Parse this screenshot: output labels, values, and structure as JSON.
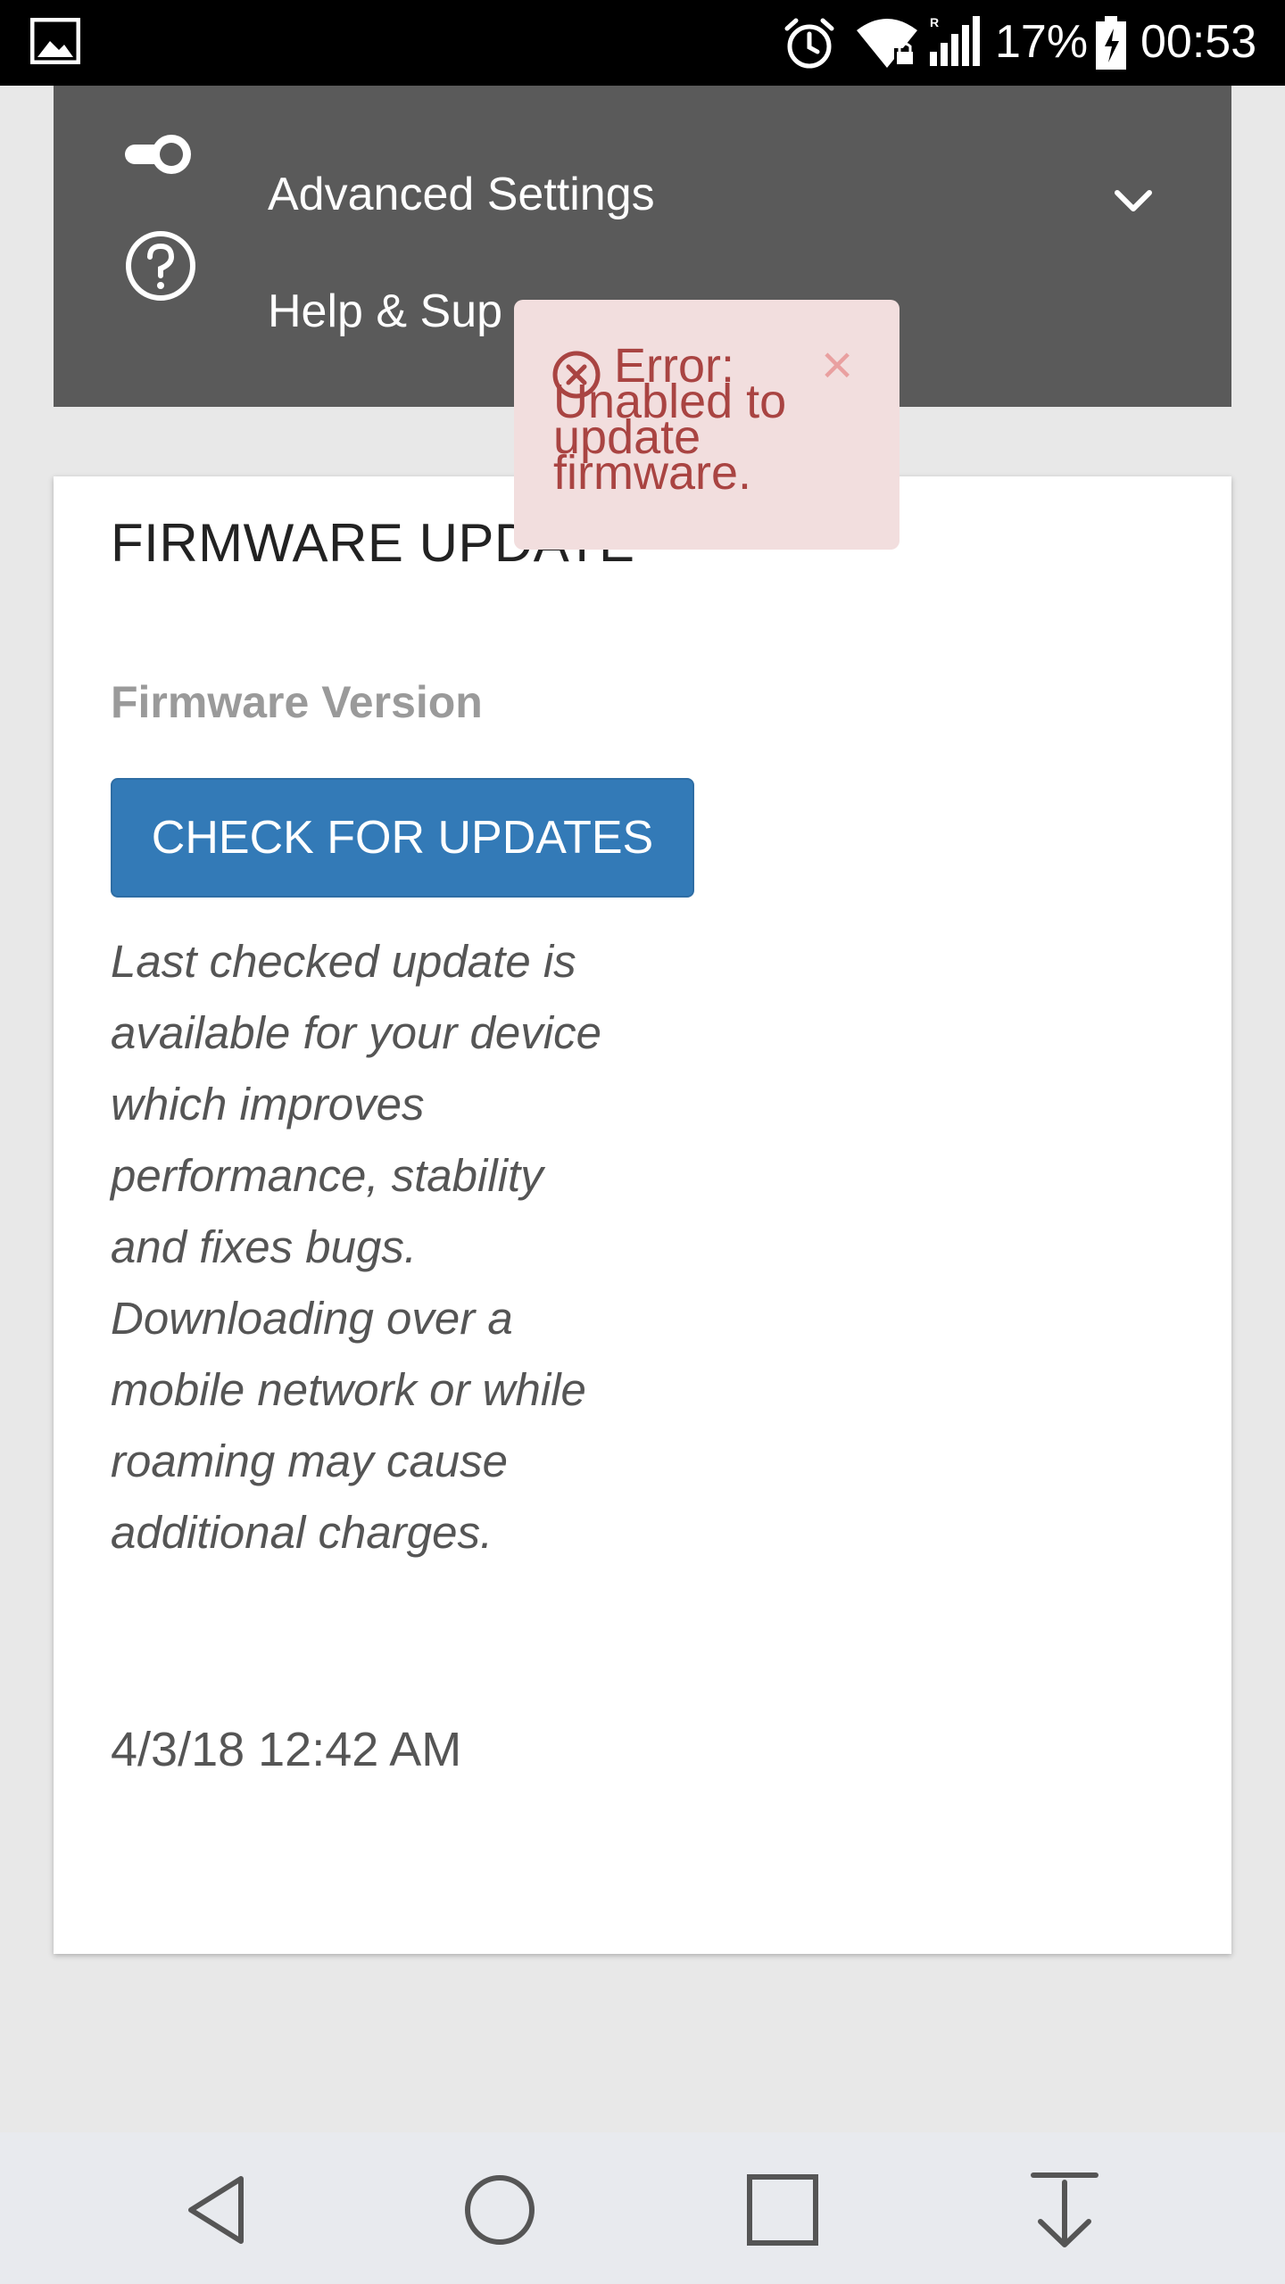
{
  "status_bar": {
    "battery_percent": "17%",
    "time": "00:53",
    "icons": [
      "gallery-icon",
      "alarm-icon",
      "wifi-lock-icon",
      "signal-icon",
      "battery-charging-icon"
    ]
  },
  "menu": {
    "items": [
      {
        "label": "Advanced Settings",
        "icon": "toggle-icon"
      },
      {
        "label": "Help & Sup",
        "icon": "help-circle-icon"
      }
    ]
  },
  "card": {
    "title": "FIRMWARE UPDATE",
    "firmware_label": "Firmware Version",
    "check_button": "CHECK FOR UPDATES",
    "description": "Last checked update is available for your device which improves performance, stability and fixes bugs. Downloading over a mobile network or while roaming may cause additional charges.",
    "last_checked": "4/3/18 12:42 AM"
  },
  "toast": {
    "message": "Error: Unabled to update firmware.",
    "close": "×"
  },
  "colors": {
    "menu_bg": "#5a5a5a",
    "button_primary": "#337ab7",
    "toast_bg": "#f2dede",
    "toast_text": "#a94442"
  }
}
